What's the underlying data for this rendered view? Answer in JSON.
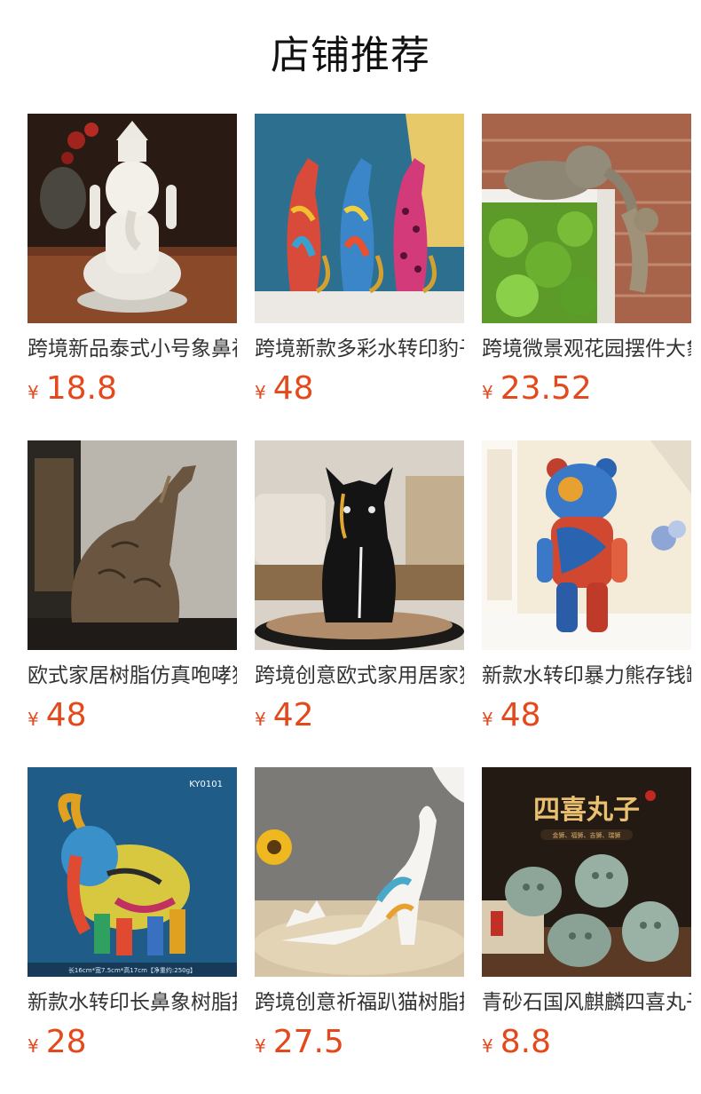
{
  "section_title": "店铺推荐",
  "currency_symbol": "¥",
  "colors": {
    "price": "#e4481b",
    "title": "#111111",
    "name": "#333333"
  },
  "products": [
    {
      "name": "跨境新品泰式小号象鼻神摆件",
      "price": "18.8",
      "image": "white-ganesha-statue"
    },
    {
      "name": "跨境新款多彩水转印豹子摆件",
      "price": "48",
      "image": "three-colorful-leopards"
    },
    {
      "name": "跨境微景观花园摆件大象挂件",
      "price": "23.52",
      "image": "elephant-shelf-sitter"
    },
    {
      "name": "欧式家居树脂仿真咆哮狼摆件",
      "price": "48",
      "image": "bronze-howling-wolf"
    },
    {
      "name": "跨境创意欧式家用居家狗摆件",
      "price": "42",
      "image": "black-bulldog-statue"
    },
    {
      "name": "新款水转印暴力熊存钱罐摆件",
      "price": "48",
      "image": "graffiti-bear-figure"
    },
    {
      "name": "新款水转印长鼻象树脂摆件",
      "price": "28",
      "image": "graffiti-elephant-figure",
      "image_caption": "KY0101",
      "image_footer": "长16cm*宽7.5cm*高17cm【净重约:250g】"
    },
    {
      "name": "跨境创意祈福趴猫树脂摆件",
      "price": "27.5",
      "image": "stretching-white-cat"
    },
    {
      "name": "青砂石国风麒麟四喜丸子摆件",
      "price": "8.8",
      "image": "green-stone-lions",
      "image_caption": "四喜丸子",
      "image_subcaption": "金狮、福狮、吉狮、瑞狮"
    }
  ]
}
